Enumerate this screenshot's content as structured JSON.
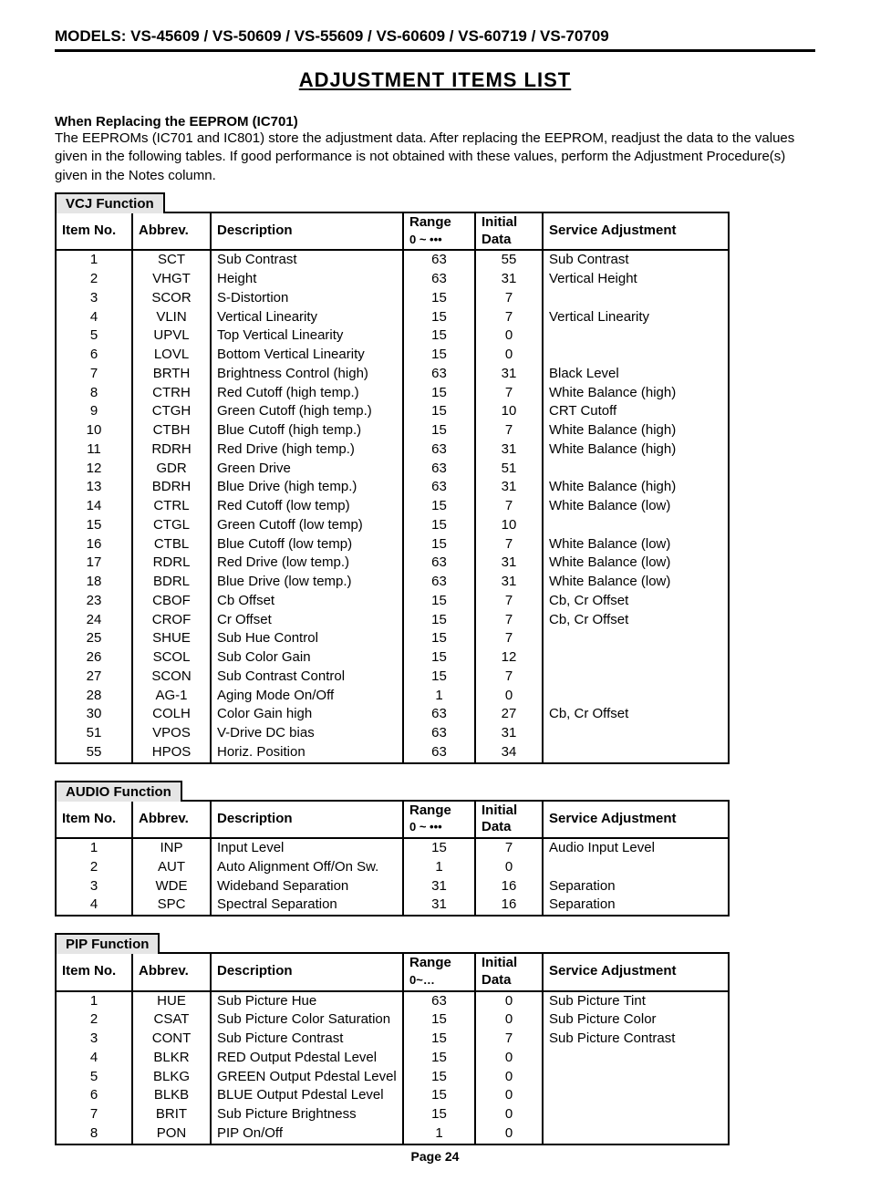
{
  "header": {
    "models_prefix": "MODELS:",
    "models_list": "VS-45609 / VS-50609 / VS-55609 / VS-60609 / VS-60719 / VS-70709"
  },
  "title": "ADJUSTMENT  ITEMS  LIST",
  "intro": {
    "heading": "When Replacing the EEPROM (IC701)",
    "body": "The EEPROMs (IC701 and IC801) store the adjustment data.  After replacing the EEPROM, readjust the data to the values given in the following tables.  If good performance is not obtained with these values, perform the Adjustment Procedure(s) given in the Notes column."
  },
  "columns": {
    "item_no": "Item No.",
    "abbrev": "Abbrev.",
    "description": "Description",
    "range_top": "Range",
    "range_sub_dots": "0 ~ •••",
    "range_sub_ell": "0~…",
    "initial_top": "Initial",
    "initial_bot": "Data",
    "service_adj": "Service Adjustment"
  },
  "tables": {
    "vcj": {
      "title": "VCJ Function",
      "rows": [
        {
          "no": "1",
          "ab": "SCT",
          "desc": "Sub Contrast",
          "rng": "63",
          "init": "55",
          "adj": "Sub Contrast"
        },
        {
          "no": "2",
          "ab": "VHGT",
          "desc": "Height",
          "rng": "63",
          "init": "31",
          "adj": "Vertical Height"
        },
        {
          "no": "3",
          "ab": "SCOR",
          "desc": "S-Distortion",
          "rng": "15",
          "init": "7",
          "adj": ""
        },
        {
          "no": "4",
          "ab": "VLIN",
          "desc": "Vertical Linearity",
          "rng": "15",
          "init": "7",
          "adj": "Vertical Linearity"
        },
        {
          "no": "5",
          "ab": "UPVL",
          "desc": "Top Vertical Linearity",
          "rng": "15",
          "init": "0",
          "adj": ""
        },
        {
          "no": "6",
          "ab": "LOVL",
          "desc": "Bottom Vertical Linearity",
          "rng": "15",
          "init": "0",
          "adj": ""
        },
        {
          "no": "7",
          "ab": "BRTH",
          "desc": "Brightness Control (high)",
          "rng": "63",
          "init": "31",
          "adj": "Black Level"
        },
        {
          "no": "8",
          "ab": "CTRH",
          "desc": "Red Cutoff (high temp.)",
          "rng": "15",
          "init": "7",
          "adj": "White Balance (high)"
        },
        {
          "no": "9",
          "ab": "CTGH",
          "desc": "Green Cutoff (high temp.)",
          "rng": "15",
          "init": "10",
          "adj": "CRT Cutoff"
        },
        {
          "no": "10",
          "ab": "CTBH",
          "desc": "Blue Cutoff (high temp.)",
          "rng": "15",
          "init": "7",
          "adj": "White Balance (high)"
        },
        {
          "no": "11",
          "ab": "RDRH",
          "desc": "Red Drive (high temp.)",
          "rng": "63",
          "init": "31",
          "adj": "White Balance (high)"
        },
        {
          "no": "12",
          "ab": "GDR",
          "desc": "Green Drive",
          "rng": "63",
          "init": "51",
          "adj": ""
        },
        {
          "no": "13",
          "ab": "BDRH",
          "desc": "Blue Drive (high temp.)",
          "rng": "63",
          "init": "31",
          "adj": "White Balance (high)"
        },
        {
          "no": "14",
          "ab": "CTRL",
          "desc": "Red Cutoff (low temp)",
          "rng": "15",
          "init": "7",
          "adj": "White Balance (low)"
        },
        {
          "no": "15",
          "ab": "CTGL",
          "desc": "Green Cutoff (low temp)",
          "rng": "15",
          "init": "10",
          "adj": ""
        },
        {
          "no": "16",
          "ab": "CTBL",
          "desc": "Blue Cutoff (low temp)",
          "rng": "15",
          "init": "7",
          "adj": "White Balance (low)"
        },
        {
          "no": "17",
          "ab": "RDRL",
          "desc": "Red Drive (low temp.)",
          "rng": "63",
          "init": "31",
          "adj": "White Balance (low)"
        },
        {
          "no": "18",
          "ab": "BDRL",
          "desc": "Blue Drive (low temp.)",
          "rng": "63",
          "init": "31",
          "adj": "White Balance (low)"
        },
        {
          "no": "23",
          "ab": "CBOF",
          "desc": "Cb Offset",
          "rng": "15",
          "init": "7",
          "adj": "Cb, Cr Offset"
        },
        {
          "no": "24",
          "ab": "CROF",
          "desc": "Cr Offset",
          "rng": "15",
          "init": "7",
          "adj": "Cb, Cr Offset"
        },
        {
          "no": "25",
          "ab": "SHUE",
          "desc": "Sub Hue Control",
          "rng": "15",
          "init": "7",
          "adj": ""
        },
        {
          "no": "26",
          "ab": "SCOL",
          "desc": "Sub Color Gain",
          "rng": "15",
          "init": "12",
          "adj": ""
        },
        {
          "no": "27",
          "ab": "SCON",
          "desc": "Sub Contrast Control",
          "rng": "15",
          "init": "7",
          "adj": ""
        },
        {
          "no": "28",
          "ab": "AG-1",
          "desc": "Aging Mode On/Off",
          "rng": "1",
          "init": "0",
          "adj": ""
        },
        {
          "no": "30",
          "ab": "COLH",
          "desc": "Color Gain high",
          "rng": "63",
          "init": "27",
          "adj": "Cb, Cr Offset"
        },
        {
          "no": "51",
          "ab": "VPOS",
          "desc": "V-Drive DC bias",
          "rng": "63",
          "init": "31",
          "adj": ""
        },
        {
          "no": "55",
          "ab": "HPOS",
          "desc": "Horiz. Position",
          "rng": "63",
          "init": "34",
          "adj": ""
        }
      ]
    },
    "audio": {
      "title": "AUDIO  Function",
      "rows": [
        {
          "no": "1",
          "ab": "INP",
          "desc": "Input Level",
          "rng": "15",
          "init": "7",
          "adj": "Audio Input Level"
        },
        {
          "no": "2",
          "ab": "AUT",
          "desc": "Auto Alignment Off/On Sw.",
          "rng": "1",
          "init": "0",
          "adj": ""
        },
        {
          "no": "3",
          "ab": "WDE",
          "desc": "Wideband Separation",
          "rng": "31",
          "init": "16",
          "adj": "Separation"
        },
        {
          "no": "4",
          "ab": "SPC",
          "desc": "Spectral Separation",
          "rng": "31",
          "init": "16",
          "adj": "Separation"
        }
      ]
    },
    "pip": {
      "title": "PIP Function",
      "rows": [
        {
          "no": "1",
          "ab": "HUE",
          "desc": "Sub Picture Hue",
          "rng": "63",
          "init": "0",
          "adj": "Sub Picture Tint"
        },
        {
          "no": "2",
          "ab": "CSAT",
          "desc": "Sub Picture Color Saturation",
          "rng": "15",
          "init": "0",
          "adj": "Sub Picture Color"
        },
        {
          "no": "3",
          "ab": "CONT",
          "desc": "Sub Picture Contrast",
          "rng": "15",
          "init": "7",
          "adj": "Sub Picture Contrast"
        },
        {
          "no": "4",
          "ab": "BLKR",
          "desc": "RED Output Pdestal Level",
          "rng": "15",
          "init": "0",
          "adj": ""
        },
        {
          "no": "5",
          "ab": "BLKG",
          "desc": "GREEN Output Pdestal Level",
          "rng": "15",
          "init": "0",
          "adj": ""
        },
        {
          "no": "6",
          "ab": "BLKB",
          "desc": "BLUE Output Pdestal Level",
          "rng": "15",
          "init": "0",
          "adj": ""
        },
        {
          "no": "7",
          "ab": "BRIT",
          "desc": "Sub Picture Brightness",
          "rng": "15",
          "init": "0",
          "adj": ""
        },
        {
          "no": "8",
          "ab": "PON",
          "desc": "PIP On/Off",
          "rng": "1",
          "init": "0",
          "adj": ""
        }
      ]
    }
  },
  "footer": "Page 24"
}
